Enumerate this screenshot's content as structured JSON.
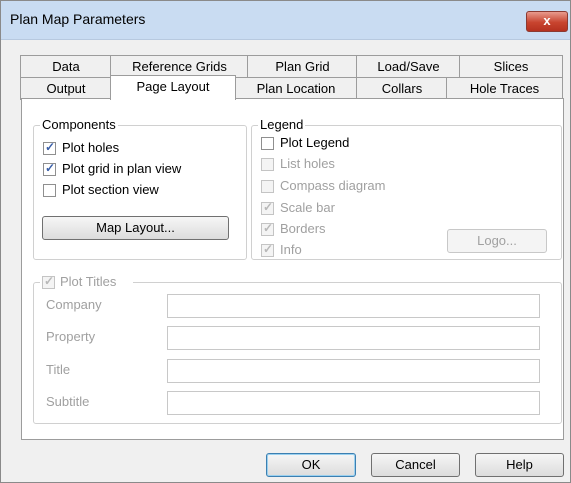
{
  "window": {
    "title": "Plan Map Parameters",
    "close_glyph": "x"
  },
  "tabs": {
    "row1": [
      "Data",
      "Reference Grids",
      "Plan Grid",
      "Load/Save",
      "Slices"
    ],
    "row2": [
      "Output",
      "Page Layout",
      "Plan Location",
      "Collars",
      "Hole Traces"
    ],
    "active": "Page Layout"
  },
  "components": {
    "title": "Components",
    "plot_holes": {
      "label": "Plot holes",
      "checked": true
    },
    "plot_grid": {
      "label": "Plot grid in plan view",
      "checked": true
    },
    "plot_section": {
      "label": "Plot section view",
      "checked": false
    },
    "map_layout_button": "Map Layout..."
  },
  "legend": {
    "title": "Legend",
    "plot_legend": {
      "label": "Plot Legend",
      "checked": false
    },
    "list_holes": {
      "label": "List holes",
      "checked": false
    },
    "compass_diagram": {
      "label": "Compass diagram",
      "checked": false
    },
    "scale_bar": {
      "label": "Scale bar",
      "checked": true
    },
    "borders": {
      "label": "Borders",
      "checked": true
    },
    "info": {
      "label": "Info",
      "checked": true
    },
    "logo_button": "Logo..."
  },
  "plot_titles": {
    "label": "Plot Titles",
    "checked": true,
    "company_label": "Company",
    "property_label": "Property",
    "title_label": "Title",
    "subtitle_label": "Subtitle",
    "company_value": "",
    "property_value": "",
    "title_value": "",
    "subtitle_value": ""
  },
  "buttons": {
    "ok": "OK",
    "cancel": "Cancel",
    "help": "Help"
  }
}
